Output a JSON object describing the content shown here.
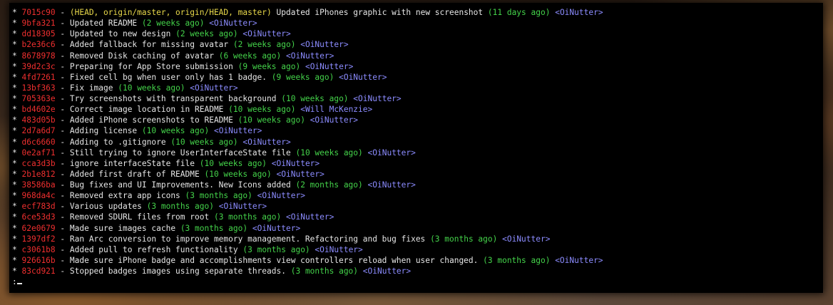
{
  "terminal": {
    "commits": [
      {
        "hash": "7015c90",
        "refs": "(HEAD, origin/master, origin/HEAD, master)",
        "message": "Updated iPhones graphic with new screenshot",
        "when": "(11 days ago)",
        "author": "<OiNutter>"
      },
      {
        "hash": "9bfa321",
        "refs": "",
        "message": "Updated README",
        "when": "(2 weeks ago)",
        "author": "<OiNutter>"
      },
      {
        "hash": "dd18305",
        "refs": "",
        "message": "Updated to new design",
        "when": "(2 weeks ago)",
        "author": "<OiNutter>"
      },
      {
        "hash": "b2e36c6",
        "refs": "",
        "message": "Added fallback for missing avatar",
        "when": "(2 weeks ago)",
        "author": "<OiNutter>"
      },
      {
        "hash": "8678978",
        "refs": "",
        "message": "Removed Disk caching of avatar",
        "when": "(6 weeks ago)",
        "author": "<OiNutter>"
      },
      {
        "hash": "39d2c3c",
        "refs": "",
        "message": "Preparing for App Store submission",
        "when": "(9 weeks ago)",
        "author": "<OiNutter>"
      },
      {
        "hash": "4fd7261",
        "refs": "",
        "message": "Fixed cell bg when user only has 1 badge.",
        "when": "(9 weeks ago)",
        "author": "<OiNutter>"
      },
      {
        "hash": "13bf363",
        "refs": "",
        "message": "Fix image",
        "when": "(10 weeks ago)",
        "author": "<OiNutter>"
      },
      {
        "hash": "705363e",
        "refs": "",
        "message": "Try screenshots with transparent background",
        "when": "(10 weeks ago)",
        "author": "<OiNutter>"
      },
      {
        "hash": "bd4602e",
        "refs": "",
        "message": "Correct image location in README",
        "when": "(10 weeks ago)",
        "author": "<Will McKenzie>"
      },
      {
        "hash": "483d05b",
        "refs": "",
        "message": "Added iPhone screenshots to README",
        "when": "(10 weeks ago)",
        "author": "<OiNutter>"
      },
      {
        "hash": "2d7a6d7",
        "refs": "",
        "message": "Adding license",
        "when": "(10 weeks ago)",
        "author": "<OiNutter>"
      },
      {
        "hash": "d6c6660",
        "refs": "",
        "message": "Adding to .gitignore",
        "when": "(10 weeks ago)",
        "author": "<OiNutter>"
      },
      {
        "hash": "0e2af71",
        "refs": "",
        "message": "Still trying to ignore UserInterfaceState file",
        "when": "(10 weeks ago)",
        "author": "<OiNutter>"
      },
      {
        "hash": "cca3d3b",
        "refs": "",
        "message": "ignore interfaceState file",
        "when": "(10 weeks ago)",
        "author": "<OiNutter>"
      },
      {
        "hash": "2b1e812",
        "refs": "",
        "message": "Added first draft of README",
        "when": "(10 weeks ago)",
        "author": "<OiNutter>"
      },
      {
        "hash": "38586ba",
        "refs": "",
        "message": "Bug fixes and UI Improvements. New Icons added",
        "when": "(2 months ago)",
        "author": "<OiNutter>"
      },
      {
        "hash": "968da4c",
        "refs": "",
        "message": "Removed extra app icons",
        "when": "(3 months ago)",
        "author": "<OiNutter>"
      },
      {
        "hash": "ecf783d",
        "refs": "",
        "message": "Various updates",
        "when": "(3 months ago)",
        "author": "<OiNutter>"
      },
      {
        "hash": "6ce53d3",
        "refs": "",
        "message": "Removed SDURL files from root",
        "when": "(3 months ago)",
        "author": "<OiNutter>"
      },
      {
        "hash": "62e0679",
        "refs": "",
        "message": "Made sure images cache",
        "when": "(3 months ago)",
        "author": "<OiNutter>"
      },
      {
        "hash": "1397df2",
        "refs": "",
        "message": "Ran Arc conversion to improve memory management. Refactoring and bug fixes",
        "when": "(3 months ago)",
        "author": "<OiNutter>"
      },
      {
        "hash": "c3061b8",
        "refs": "",
        "message": "Added pull to refresh functionality",
        "when": "(3 months ago)",
        "author": "<OiNutter>"
      },
      {
        "hash": "926616b",
        "refs": "",
        "message": "Made sure iPhone badge and accomplishments view controllers reload when user changed.",
        "when": "(3 months ago)",
        "author": "<OiNutter>"
      },
      {
        "hash": "83cd921",
        "refs": "",
        "message": "Stopped badges images using separate threads.",
        "when": "(3 months ago)",
        "author": "<OiNutter>"
      }
    ],
    "prompt": ":",
    "colors": {
      "background": "#000000",
      "hash": "#ef2f2f",
      "refs": "#e8d84a",
      "message": "#e6e6e6",
      "when": "#44d34a",
      "author": "#8c8cff"
    }
  }
}
